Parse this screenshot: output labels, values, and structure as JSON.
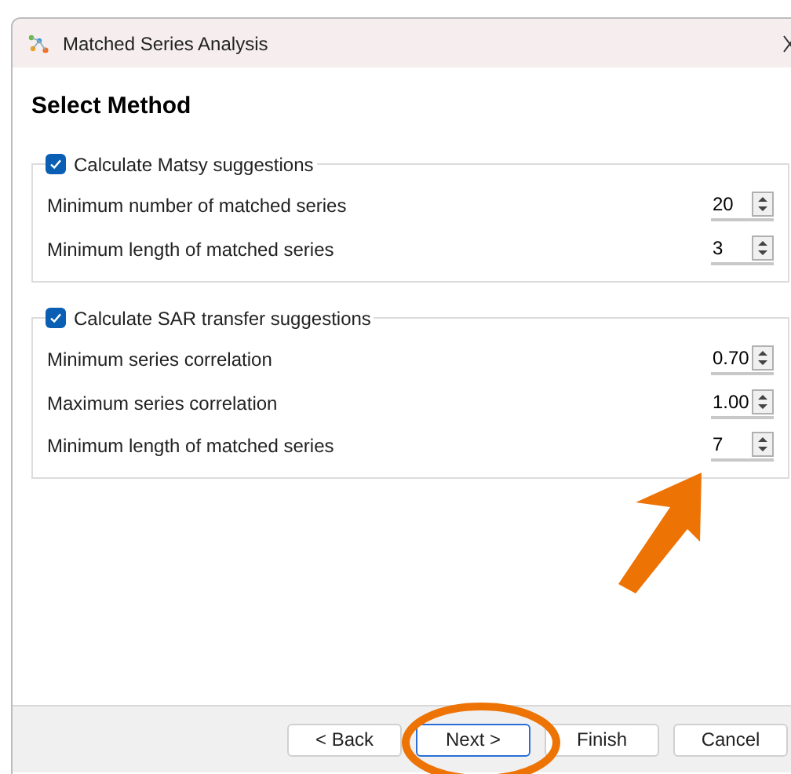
{
  "window": {
    "title": "Matched Series Analysis"
  },
  "heading": "Select Method",
  "groups": [
    {
      "label": "Calculate Matsy suggestions",
      "checked": true,
      "fields": [
        {
          "label": "Minimum number of matched series",
          "value": "20"
        },
        {
          "label": "Minimum length of matched series",
          "value": "3"
        }
      ]
    },
    {
      "label": "Calculate SAR transfer suggestions",
      "checked": true,
      "fields": [
        {
          "label": "Minimum series correlation",
          "value": "0.70"
        },
        {
          "label": "Maximum series correlation",
          "value": "1.00"
        },
        {
          "label": "Minimum length of matched series",
          "value": "7"
        }
      ]
    }
  ],
  "buttons": [
    {
      "label": "< Back",
      "default": false
    },
    {
      "label": "Next >",
      "default": true
    },
    {
      "label": "Finish",
      "default": false
    },
    {
      "label": "Cancel",
      "default": false
    }
  ]
}
